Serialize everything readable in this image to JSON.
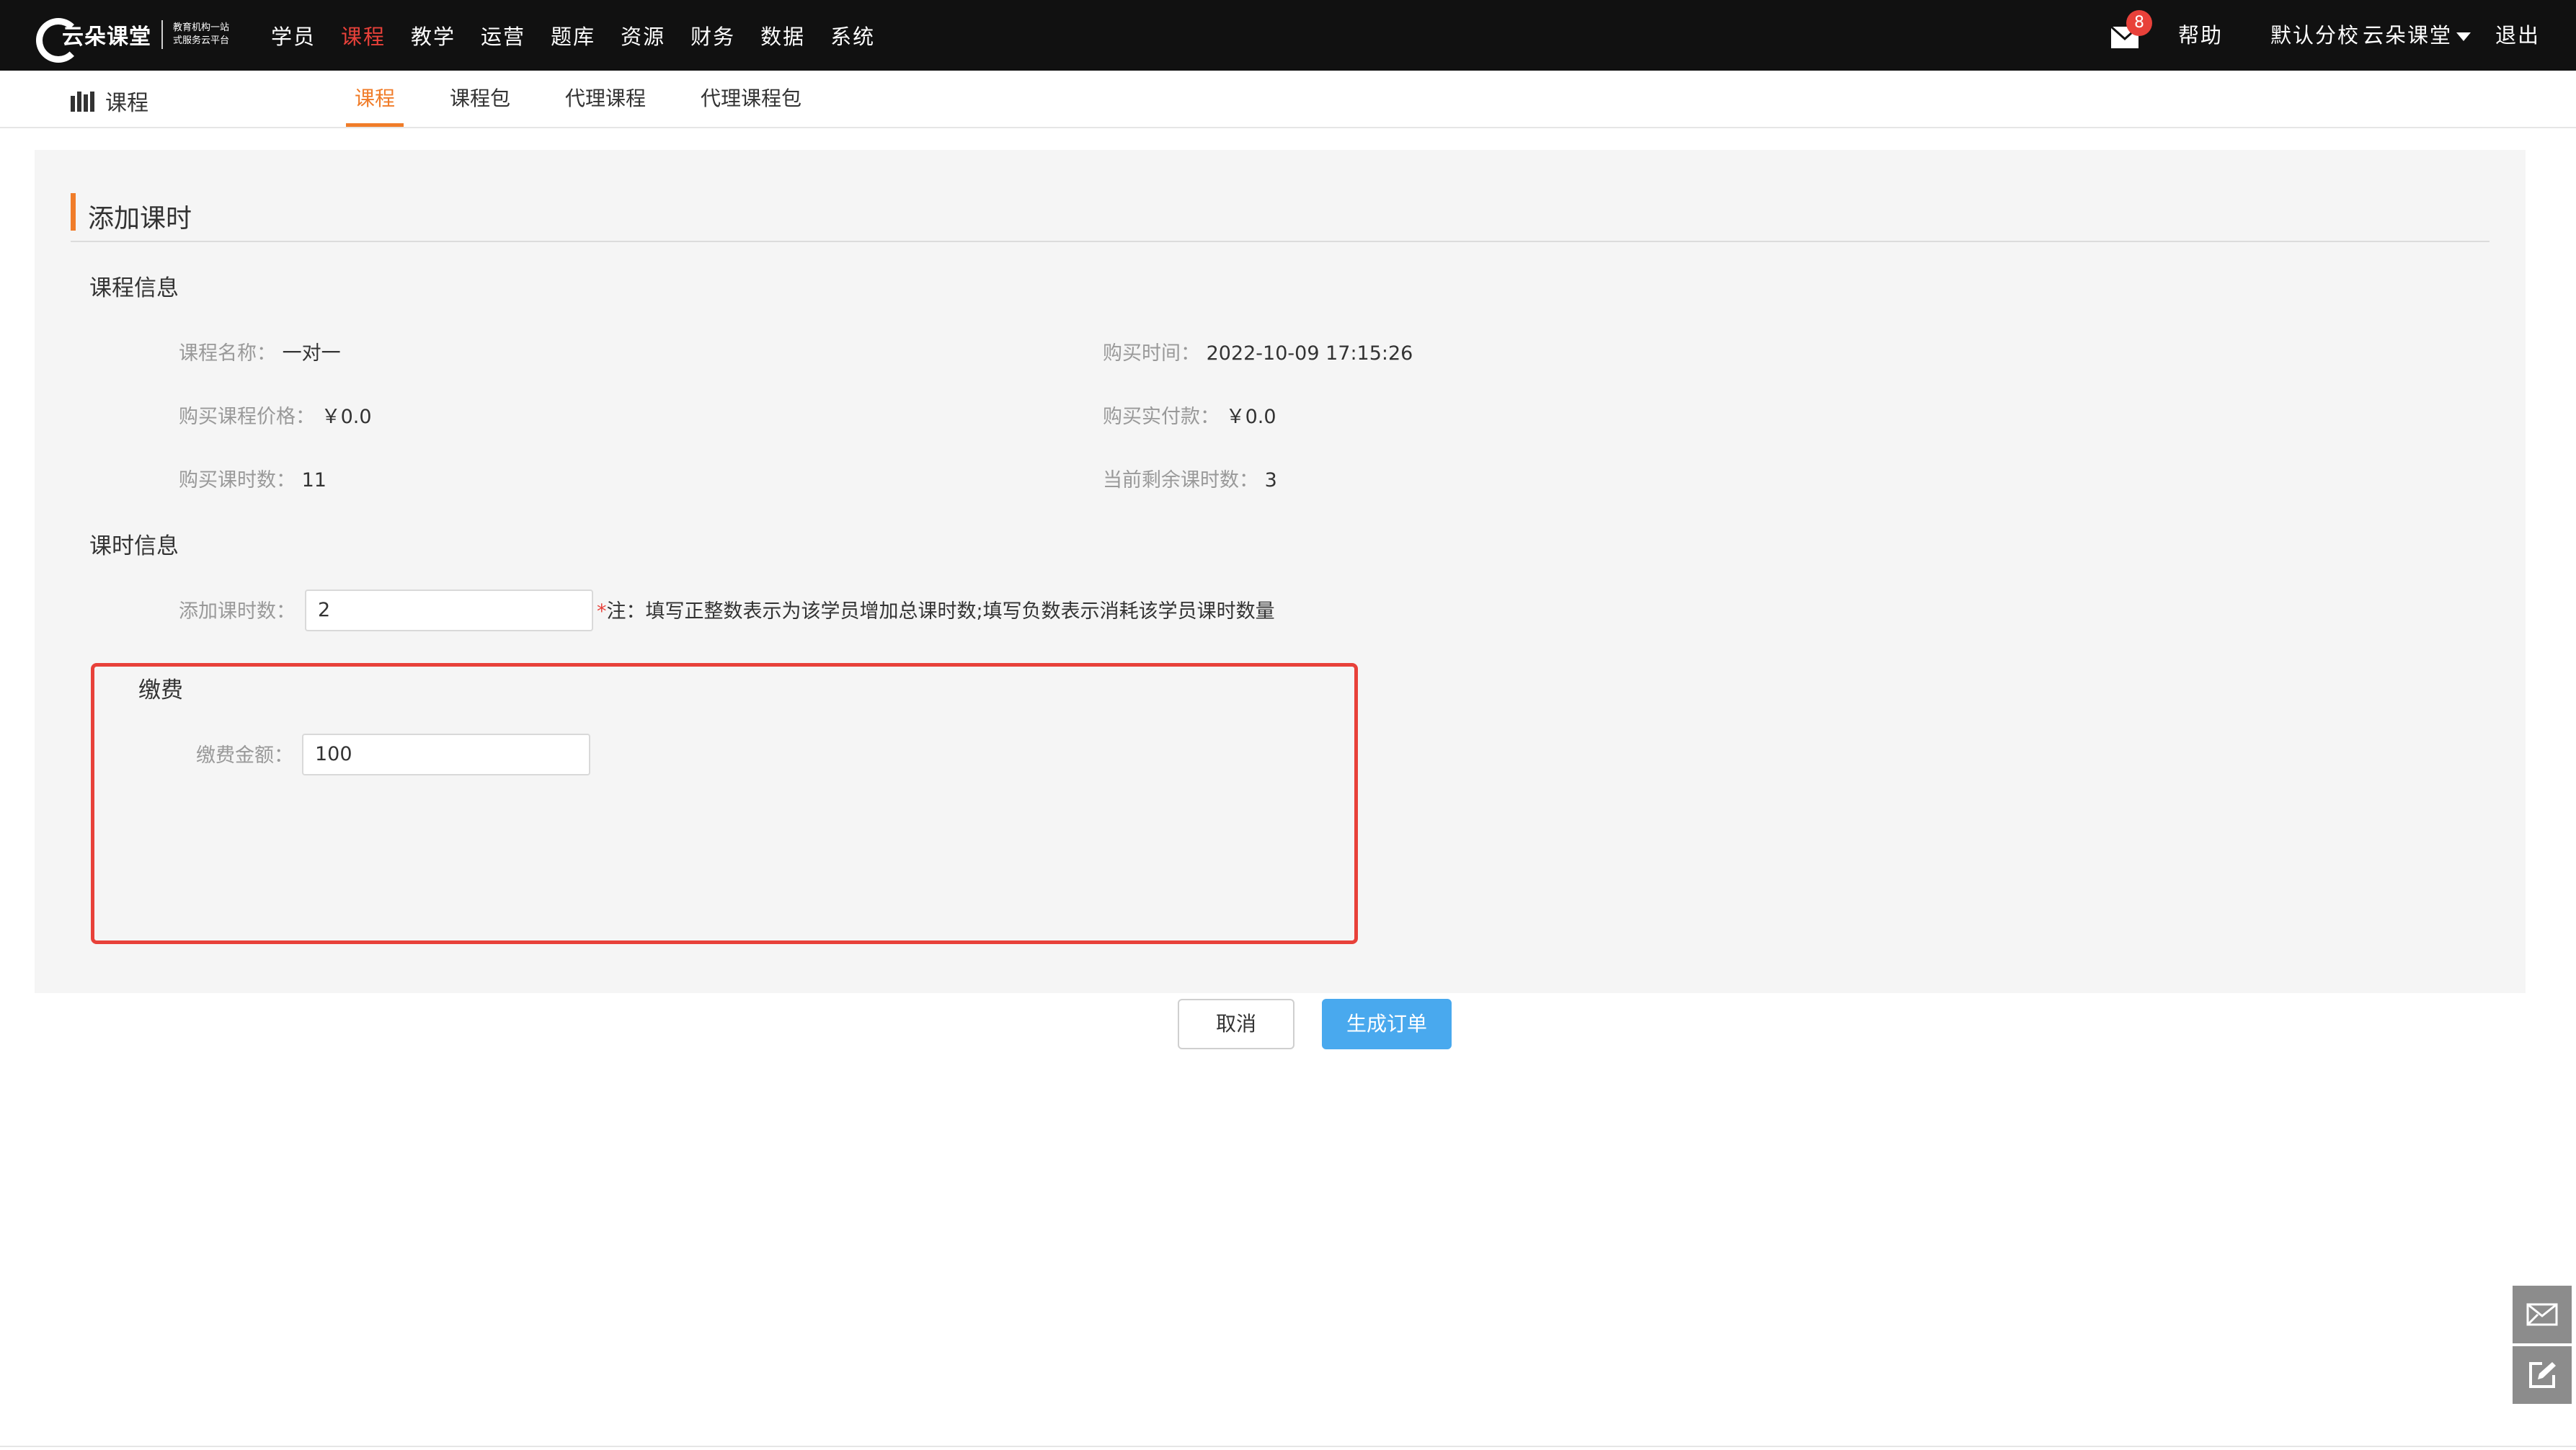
{
  "header": {
    "logo_text": "云朵课堂",
    "logo_tagline": "教育机构一站式服务云平台",
    "nav": [
      {
        "label": "学员",
        "active": false
      },
      {
        "label": "课程",
        "active": true
      },
      {
        "label": "教学",
        "active": false
      },
      {
        "label": "运营",
        "active": false
      },
      {
        "label": "题库",
        "active": false
      },
      {
        "label": "资源",
        "active": false
      },
      {
        "label": "财务",
        "active": false
      },
      {
        "label": "数据",
        "active": false
      },
      {
        "label": "系统",
        "active": false
      }
    ],
    "mail_badge": "8",
    "help": "帮助",
    "branch": "默认分校",
    "org": "云朵课堂",
    "logout": "退出"
  },
  "subnav": {
    "section": "课程",
    "tabs": [
      "课程",
      "课程包",
      "代理课程",
      "代理课程包"
    ],
    "active_tab": 0
  },
  "form": {
    "title": "添加课时",
    "course_info": {
      "title": "课程信息",
      "name_label": "课程名称：",
      "name_value": "一对一",
      "buy_time_label": "购买时间：",
      "buy_time_value": "2022-10-09 17:15:26",
      "price_label": "购买课程价格：",
      "price_value": "￥0.0",
      "paid_label": "购买实付款：",
      "paid_value": "￥0.0",
      "hours_label": "购买课时数：",
      "hours_value": "11",
      "remain_label": "当前剩余课时数：",
      "remain_value": "3"
    },
    "lesson_info": {
      "title": "课时信息",
      "add_label": "添加课时数：",
      "add_value": "2",
      "note_star": "*",
      "note": "注：填写正整数表示为该学员增加总课时数;填写负数表示消耗该学员课时数量"
    },
    "payment": {
      "title": "缴费",
      "amount_label": "缴费金额：",
      "amount_value": "100"
    },
    "cancel": "取消",
    "submit": "生成订单"
  },
  "colors": {
    "topbar": "#111111",
    "accent_orange": "#f07c29",
    "active_red": "#e8413a",
    "primary_blue": "#49a9ee",
    "panel_bg": "#f5f5f5"
  }
}
